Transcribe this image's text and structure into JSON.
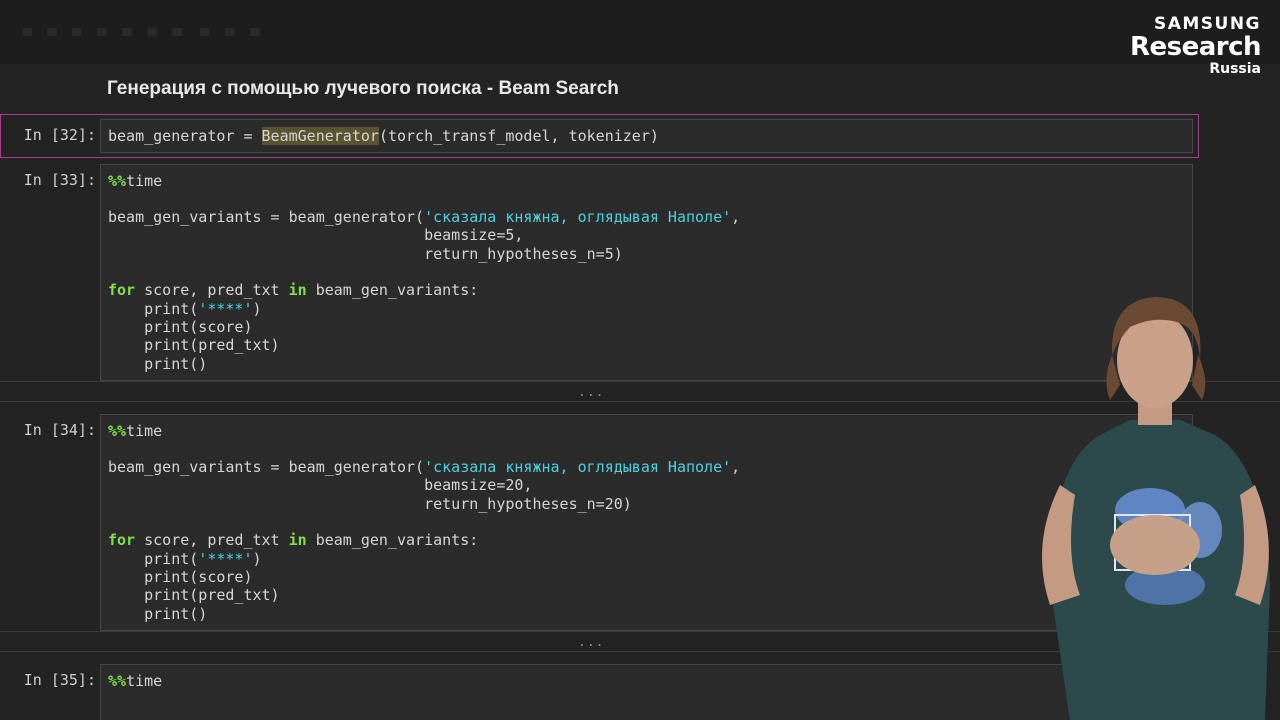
{
  "brand": {
    "line1": "SAMSUNG",
    "line2": "Research",
    "line3": "Russia"
  },
  "heading": "Генерация с помощью лучевого поиска - Beam Search",
  "cells": [
    {
      "prompt": "In [32]:",
      "line1": {
        "a": "beam_generator = ",
        "hl": "BeamGenerator",
        "b": "(torch_transf_model, tokenizer)"
      }
    },
    {
      "prompt": "In [33]:",
      "magic": "%%",
      "magic_rest": "time",
      "call_a": "beam_gen_variants = beam_generator(",
      "call_str": "'сказала княжна, оглядывая Наполе'",
      "call_b": ",",
      "arg1": "                                   beamsize=5,",
      "arg2": "                                   return_hypotheses_n=5)",
      "for_kw": "for",
      "for_mid": " score, pred_txt ",
      "in_kw": "in",
      "for_end": " beam_gen_variants:",
      "p1_fn": "    print(",
      "p1_str": "'****'",
      "p1_end": ")",
      "p2": "    print(score)",
      "p3": "    print(pred_txt)",
      "p4": "    print()"
    },
    {
      "prompt": "In [34]:",
      "magic": "%%",
      "magic_rest": "time",
      "call_a": "beam_gen_variants = beam_generator(",
      "call_str": "'сказала княжна, оглядывая Наполе'",
      "call_b": ",",
      "arg1": "                                   beamsize=20,",
      "arg2": "                                   return_hypotheses_n=20)",
      "for_kw": "for",
      "for_mid": " score, pred_txt ",
      "in_kw": "in",
      "for_end": " beam_gen_variants:",
      "p1_fn": "    print(",
      "p1_str": "'****'",
      "p1_end": ")",
      "p2": "    print(score)",
      "p3": "    print(pred_txt)",
      "p4": "    print()"
    },
    {
      "prompt": "In [35]:",
      "magic": "%%",
      "magic_rest": "time"
    }
  ],
  "ellipsis": "...",
  "colors": {
    "keyword": "#7fe04a",
    "string": "#4fd1e0",
    "selection_border": "#a63f8c"
  }
}
